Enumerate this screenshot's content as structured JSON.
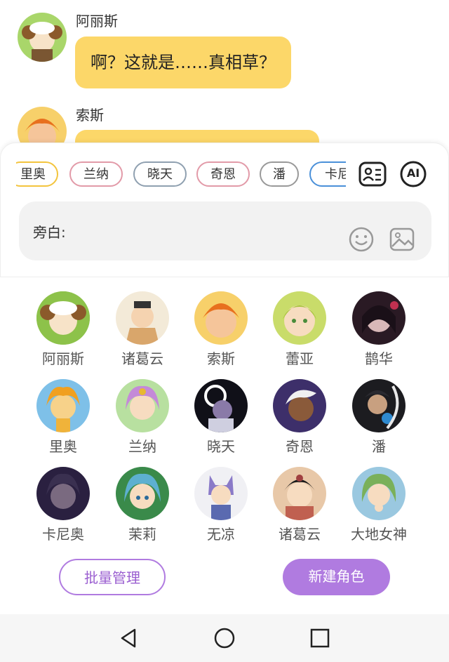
{
  "messages": [
    {
      "sender": "阿丽斯",
      "text": "啊？这就是……真相草？"
    },
    {
      "sender": "索斯",
      "text": ""
    }
  ],
  "role_chips": [
    "里奥",
    "兰纳",
    "晓天",
    "奇恩",
    "潘",
    "卡尼"
  ],
  "chip_colors": [
    "#f3c43d",
    "#e29aa8",
    "#8fa0b0",
    "#e29aa8",
    "#999999",
    "#4a90d9"
  ],
  "input": {
    "label": "旁白:"
  },
  "ai_label": "AI",
  "characters": [
    {
      "name": "阿丽斯",
      "color": "#8dc24a"
    },
    {
      "name": "诸葛云",
      "color": "#d9a66b"
    },
    {
      "name": "索斯",
      "color": "#f2a43a"
    },
    {
      "name": "蕾亚",
      "color": "#b9d34e"
    },
    {
      "name": "鹊华",
      "color": "#6b2a3a"
    },
    {
      "name": "里奥",
      "color": "#f0b33a"
    },
    {
      "name": "兰纳",
      "color": "#c48ad8"
    },
    {
      "name": "晓天",
      "color": "#2b2340"
    },
    {
      "name": "奇恩",
      "color": "#3d2f6a"
    },
    {
      "name": "潘",
      "color": "#1c2a3a"
    },
    {
      "name": "卡尼奥",
      "color": "#3a3050"
    },
    {
      "name": "茉莉",
      "color": "#5db0d0"
    },
    {
      "name": "无凉",
      "color": "#8a7ac8"
    },
    {
      "name": "诸葛云",
      "color": "#a04040"
    },
    {
      "name": "大地女神",
      "color": "#7ab05a"
    }
  ],
  "buttons": {
    "batch": "批量管理",
    "new": "新建角色"
  },
  "accent": "#b07be0"
}
